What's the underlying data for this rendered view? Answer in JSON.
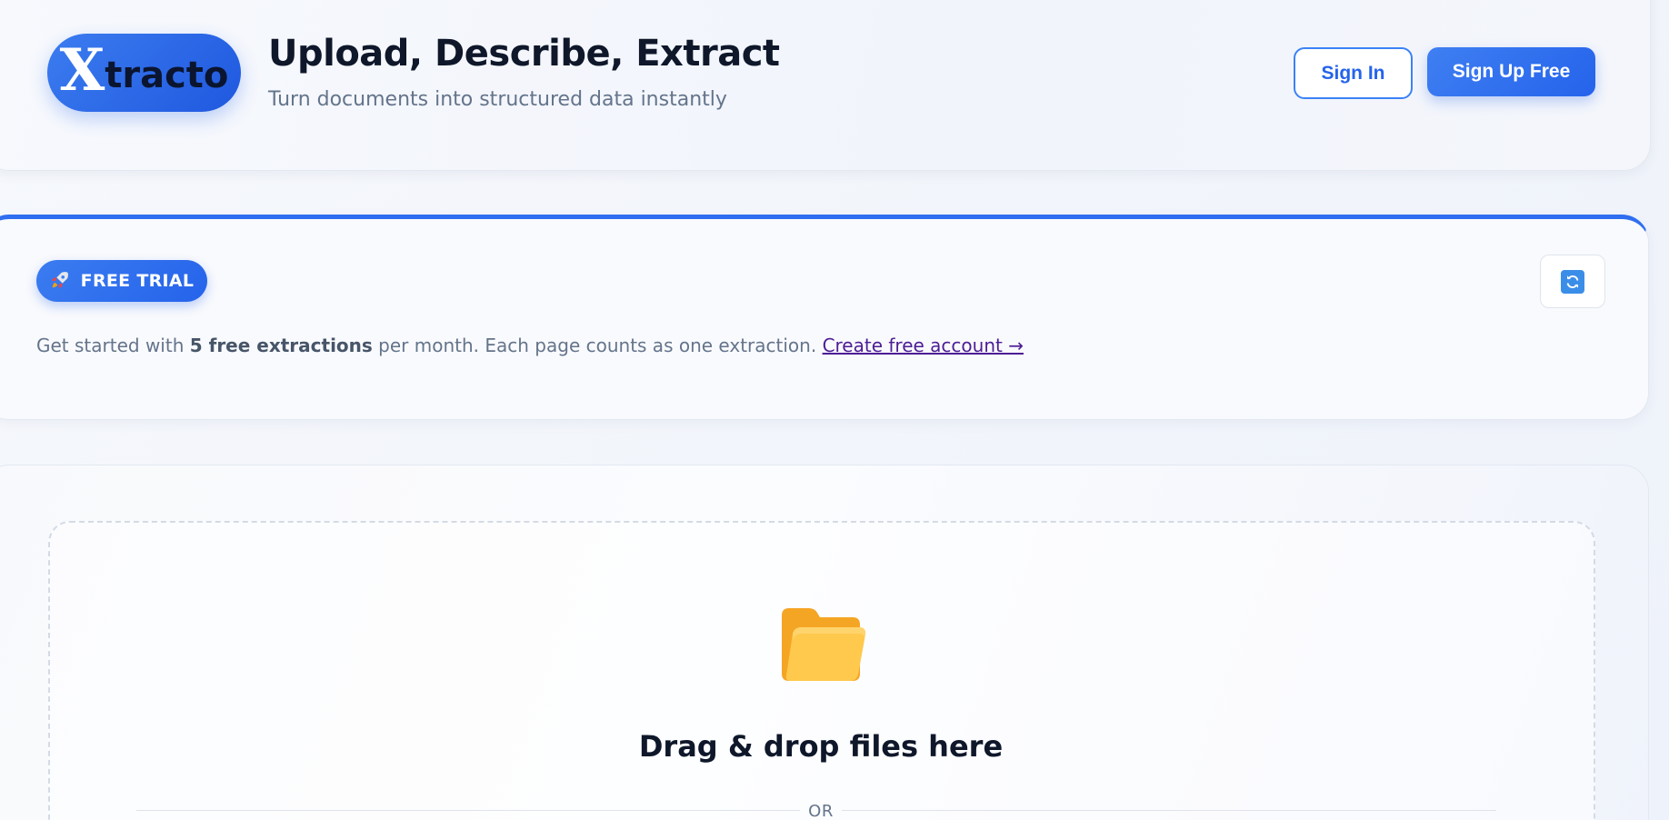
{
  "header": {
    "logo": {
      "first_letter": "X",
      "rest": "tracto"
    },
    "title": "Upload, Describe, Extract",
    "subtitle": "Turn documents into structured data instantly",
    "signin_label": "Sign In",
    "signup_label": "Sign Up Free"
  },
  "trial": {
    "badge_icon": "rocket-icon",
    "badge_label": "FREE TRIAL",
    "refresh_icon": "refresh-icon",
    "text_before": "Get started with ",
    "text_bold": "5 free extractions",
    "text_after": " per month. Each page counts as one extraction. ",
    "link_label": "Create free account →"
  },
  "upload": {
    "icon": "folder-icon",
    "title": "Drag & drop files here",
    "or_label": "OR"
  },
  "colors": {
    "accent": "#2563eb",
    "folder": "#fbbf24",
    "link": "#4c1d95"
  }
}
